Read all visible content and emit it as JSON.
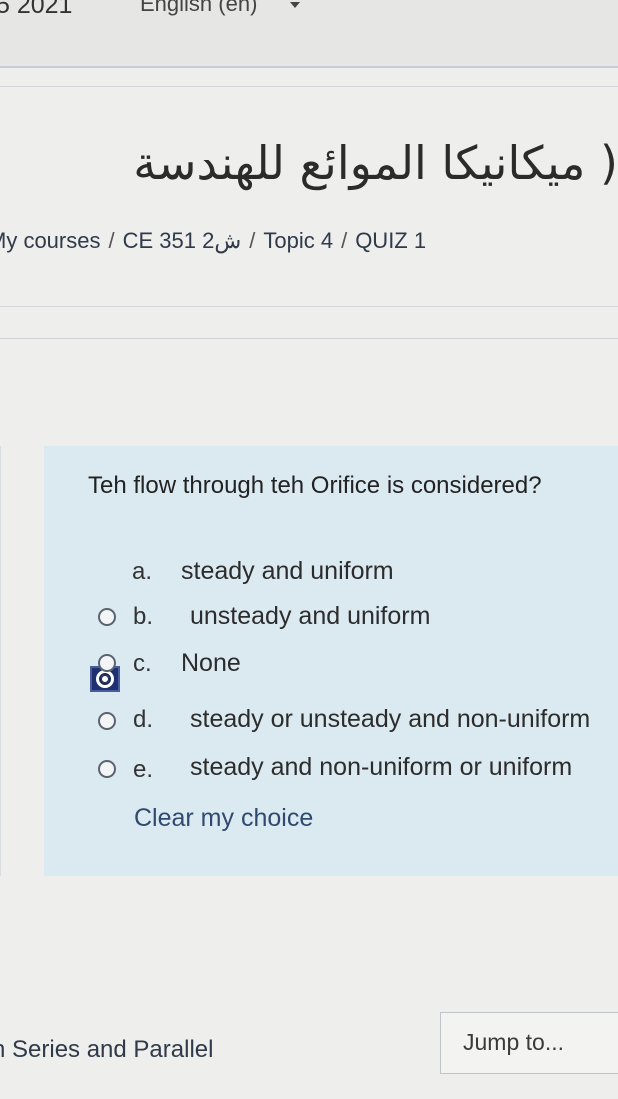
{
  "header": {
    "year": "5 2021",
    "language": "English (en)"
  },
  "course": {
    "title": "( ميكانيكا الموائع للهندسة"
  },
  "breadcrumb": {
    "items": [
      "My courses",
      "CE 351 ش2",
      "Topic 4",
      "QUIZ 1"
    ],
    "separator": "/"
  },
  "question": {
    "text": "Teh flow through teh Orifice is considered?",
    "options": [
      {
        "letter": "a.",
        "text": "steady and uniform",
        "selected": true
      },
      {
        "letter": "b.",
        "text": "unsteady and uniform",
        "selected": false
      },
      {
        "letter": "c.",
        "text": "None",
        "selected": false
      },
      {
        "letter": "d.",
        "text": "steady or unsteady and non-uniform",
        "selected": false
      },
      {
        "letter": "e.",
        "text": "steady and non-uniform or uniform",
        "selected": false
      }
    ],
    "clear_label": "Clear my choice"
  },
  "footer": {
    "prev_link": "n Series and Parallel",
    "jump_label": "Jump to..."
  },
  "colors": {
    "question_bg": "#dbe9f1",
    "selected_radio": "#1f3070"
  }
}
